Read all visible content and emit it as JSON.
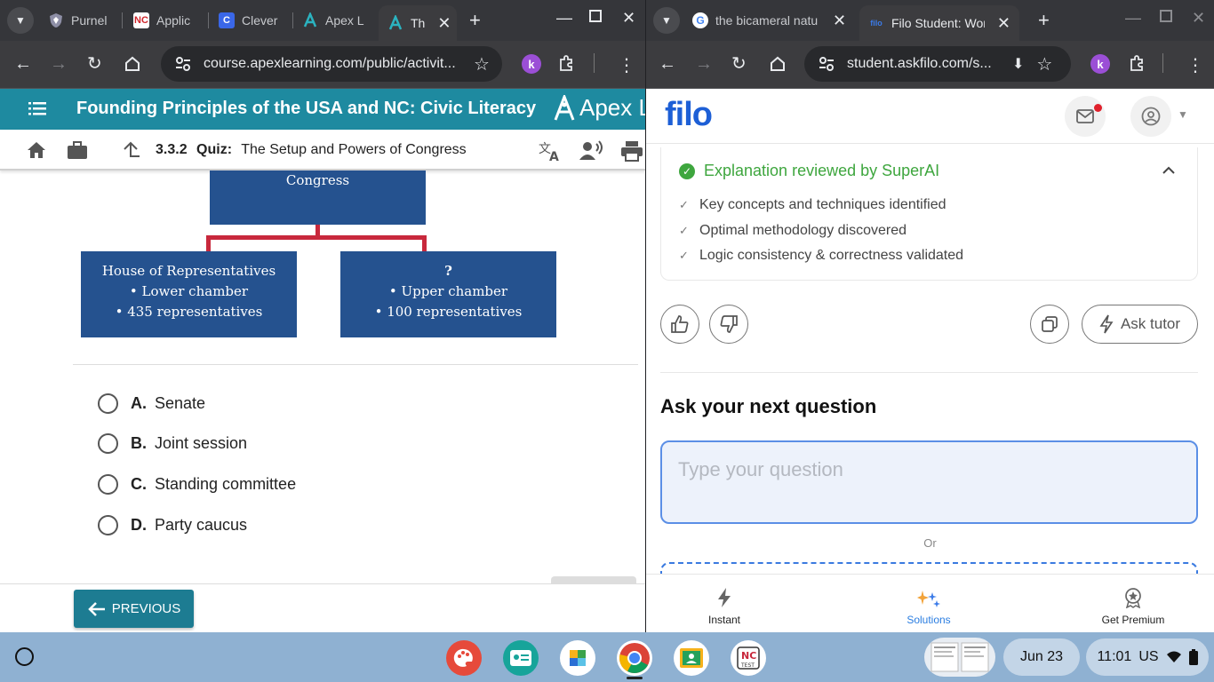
{
  "left_window": {
    "tabs": [
      {
        "title": "Purnel",
        "icon": "shield-icon",
        "color": "#8e8fa6"
      },
      {
        "title": "Applic",
        "icon": "nc-icon",
        "color": "#d0262c"
      },
      {
        "title": "Clever",
        "icon": "clever-icon",
        "color": "#3a67e8"
      },
      {
        "title": "Apex L",
        "icon": "apex-icon",
        "color": "#2bb3c0"
      },
      {
        "title": "Th",
        "icon": "apex-icon",
        "color": "#2bb3c0"
      }
    ],
    "url": "course.apexlearning.com/public/activit...",
    "course_title": "Founding Principles of the USA and NC: Civic Literacy",
    "brand": "Apex Lea",
    "quiz_number": "3.3.2",
    "quiz_label": "Quiz:",
    "quiz_title": "The Setup and Powers of Congress",
    "diagram": {
      "top": "Congress",
      "left": [
        "House of Representatives",
        "• Lower chamber",
        "• 435 representatives"
      ],
      "right": [
        "?",
        "• Upper chamber",
        "• 100 representatives"
      ]
    },
    "options": [
      {
        "letter": "A.",
        "text": "Senate"
      },
      {
        "letter": "B.",
        "text": "Joint session"
      },
      {
        "letter": "C.",
        "text": "Standing committee"
      },
      {
        "letter": "D.",
        "text": "Party caucus"
      }
    ],
    "previous_label": "PREVIOUS"
  },
  "right_window": {
    "tabs": [
      {
        "title": "the bicameral natu",
        "icon": "google-icon"
      },
      {
        "title": "Filo Student: World",
        "icon": "filo-icon"
      }
    ],
    "url": "student.askfilo.com/s...",
    "logo": "filo",
    "review_title": "Explanation reviewed by SuperAI",
    "checks": [
      "Key concepts and techniques identified",
      "Optimal methodology discovered",
      "Logic consistency & correctness validated"
    ],
    "ask_tutor": "Ask tutor",
    "ask_heading": "Ask your next question",
    "question_placeholder": "Type your question",
    "or_text": "Or",
    "bottom_nav": [
      "Instant",
      "Solutions",
      "Get Premium"
    ]
  },
  "taskbar": {
    "date": "Jun 23",
    "time": "11:01",
    "locale": "US"
  },
  "colors": {
    "apex_teal": "#1e8aa0",
    "diagram_blue": "#25528f",
    "connector_red": "#c8283c",
    "filo_blue": "#1d5fd6",
    "superai_green": "#3ea63e",
    "taskbar": "#8fb1d2"
  }
}
